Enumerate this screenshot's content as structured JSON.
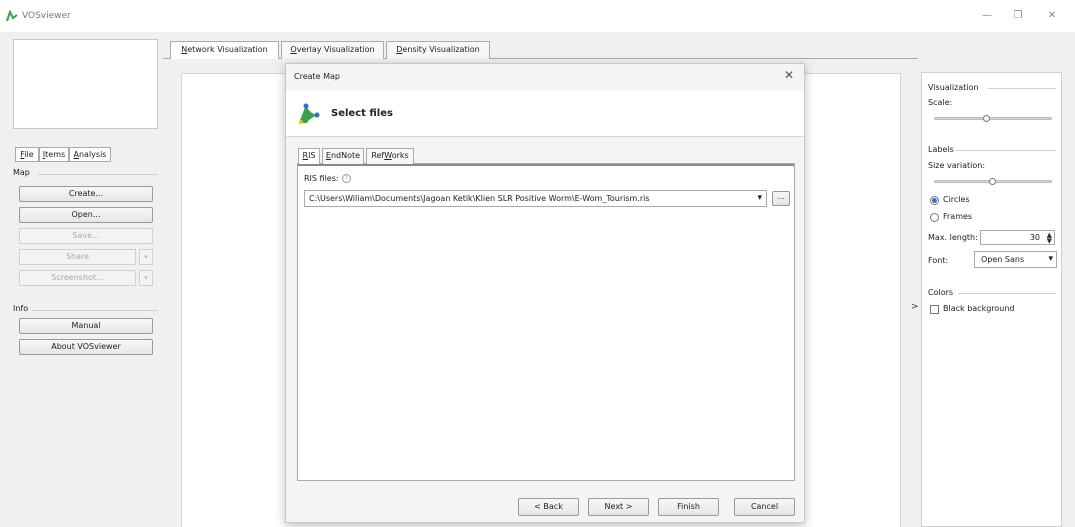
{
  "window": {
    "title": "VOSviewer",
    "minimize_glyph": "—",
    "maximize_glyph": "❐",
    "close_glyph": "✕"
  },
  "left_panel": {
    "tabs": [
      {
        "prefix": "",
        "key": "F",
        "rest": "ile"
      },
      {
        "prefix": "",
        "key": "I",
        "rest": "tems"
      },
      {
        "prefix": "",
        "key": "A",
        "rest": "nalysis"
      }
    ],
    "map_group": "Map",
    "buttons": {
      "create": "Create...",
      "open": "Open...",
      "save": "Save...",
      "share": "Share",
      "screenshot": "Screenshot...",
      "split_arrow": "▾"
    },
    "info_group": "Info",
    "info_buttons": {
      "manual": "Manual",
      "about": "About VOSviewer"
    }
  },
  "main_tabs": [
    {
      "key": "N",
      "rest": "etwork Visualization"
    },
    {
      "key": "O",
      "rest": "verlay Visualization"
    },
    {
      "key": "D",
      "rest": "ensity Visualization"
    }
  ],
  "right_panel": {
    "visualization_group": "Visualization",
    "scale_label": "Scale:",
    "scale_level": 0.45,
    "labels_group": "Labels",
    "size_variation_label": "Size variation:",
    "size_variation_level": 0.5,
    "label_shapes": [
      "Circles",
      "Frames"
    ],
    "selected_shape": "Circles",
    "max_length_label": "Max. length:",
    "max_length_value": "30",
    "font_label": "Font:",
    "font_value": "Open Sans",
    "colors_group": "Colors",
    "black_background_label": "Black background",
    "black_background_checked": false,
    "collapse_arrow": ">"
  },
  "dialog": {
    "title": "Create Map",
    "close_glyph": "✕",
    "header_title": "Select files",
    "tabs": [
      {
        "prefix": "",
        "key": "R",
        "rest": "IS"
      },
      {
        "prefix": "",
        "key": "E",
        "rest": "ndNote"
      },
      {
        "prefix": "Ref",
        "key": "W",
        "rest": "orks"
      }
    ],
    "ris_files_label": "RIS files:",
    "help_glyph": "?",
    "ris_path": "C:\\Users\\Wiliam\\Documents\\Jagoan Ketik\\Klien SLR Positive Worm\\E-Wom_Tourism.ris",
    "browse_label": "...",
    "chevron": "▾",
    "buttons": {
      "back": "< Back",
      "next": "Next >",
      "finish": "Finish",
      "cancel": "Cancel"
    }
  },
  "colors": {
    "accent": "#2f6fd6",
    "logo_green": "#3aa14a"
  }
}
